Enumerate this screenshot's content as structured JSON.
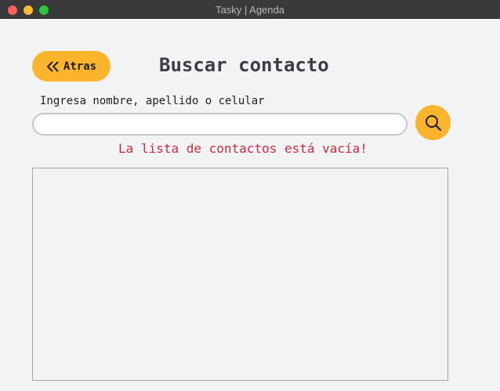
{
  "window": {
    "title": "Tasky | Agenda"
  },
  "header": {
    "back_label": "Atras",
    "title": "Buscar contacto"
  },
  "search": {
    "label": "Ingresa nombre, apellido o celular",
    "value": "",
    "placeholder": ""
  },
  "status": {
    "empty_message": "La lista de contactos está vacía!"
  },
  "icons": {
    "back": "chevrons-left-icon",
    "search": "magnifier-icon"
  },
  "colors": {
    "accent": "#fbb42c",
    "error": "#d12a3f",
    "title_text": "#3a3d42"
  }
}
